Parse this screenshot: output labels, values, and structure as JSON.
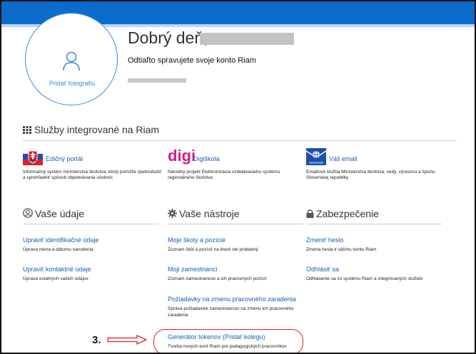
{
  "header": {
    "brand_color": "#0c6ccb"
  },
  "profile": {
    "add_photo_label": "Pridať fotografiu",
    "greeting": "Dobrý deň,",
    "subtitle": "Odtiaľto spravujete svoje konto Riam"
  },
  "services": {
    "heading": "Služby integrované na Riam",
    "items": [
      {
        "logo_icon": "flag-emblem-icon",
        "title": "Edičný portál",
        "desc": "Informačný systém ministerstva školstva, ktorý pomôže zjednodušiť a sprehľadniť spôsob objednávania učebníc"
      },
      {
        "logo_text": "digi",
        "title": "Digiškola",
        "desc": "Národný projekt Elektronizácia vzdelávacieho systému regionálneho školstva"
      },
      {
        "logo_icon": "email-globe-icon",
        "title": "Váš email",
        "desc": "Emailová služba Ministerstva školstva, vedy, výskumu a športu Slovenskej republiky"
      }
    ]
  },
  "columns": {
    "data": {
      "heading": "Vaše údaje",
      "items": [
        {
          "link": "Upraviť identifikačné údaje",
          "desc": "Úprava mena a dátumu narodenia"
        },
        {
          "link": "Upraviť kontaktné údaje",
          "desc": "Úprava ostatných vašich údajov"
        }
      ]
    },
    "tools": {
      "heading": "Vaše nástroje",
      "items": [
        {
          "link": "Moje školy a pozície",
          "desc": "Zoznam škôl a pozícií na ktoré ste pridelený"
        },
        {
          "link": "Moji zamestnanci",
          "desc": "Zoznam zamestnancov a ich pracovných pozícií"
        },
        {
          "link": "Požiadavky na zmenu pracovného zaradenia",
          "desc": "Správa požiadaviek zamestnancov na zmenu ich pracovného zaradenia"
        },
        {
          "link": "Generátor tokenov (Pridať kolegu)",
          "desc": "Tvorba nových kont Riam pre pedagogických pracovníkov"
        }
      ]
    },
    "security": {
      "heading": "Zabezpečenie",
      "items": [
        {
          "link": "Zmeniť heslo",
          "desc": "Zmena hesla k vášmu kontu Riam"
        },
        {
          "link": "Odhlásiť sa",
          "desc": "Odhlásenie sa zo systému Riam a integrovaných služieb"
        }
      ]
    }
  },
  "annotation": {
    "number": "3."
  }
}
